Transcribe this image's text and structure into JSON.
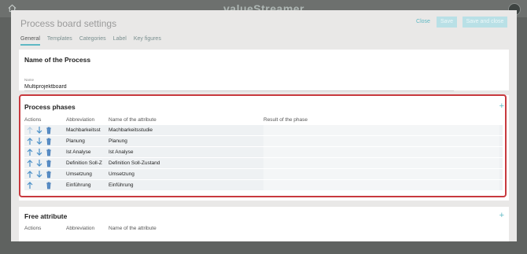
{
  "app": {
    "logo": "valueStreamer"
  },
  "modal": {
    "title": "Process board settings",
    "close_label": "Close",
    "save_label": "Save",
    "save_close_label": "Save and close"
  },
  "tabs": [
    {
      "label": "General"
    },
    {
      "label": "Templates"
    },
    {
      "label": "Categories"
    },
    {
      "label": "Label"
    },
    {
      "label": "Key figures"
    }
  ],
  "name_section": {
    "title": "Name of the Process",
    "field_label": "Name",
    "value": "Multiprojektboard"
  },
  "phases": {
    "title": "Process phases",
    "headers": {
      "actions": "Actions",
      "abbreviation": "Abbreviation",
      "name": "Name of the attribute",
      "result": "Result of the phase"
    },
    "rows": [
      {
        "abbr": "Machbarkeitsst",
        "name": "Machbarkeitsstudie",
        "result": ""
      },
      {
        "abbr": "Planung",
        "name": "Planung",
        "result": ""
      },
      {
        "abbr": "Ist Analyse",
        "name": "Ist Analyse",
        "result": ""
      },
      {
        "abbr": "Definition Soll-Z",
        "name": "Definition Soll-Zustand",
        "result": ""
      },
      {
        "abbr": "Umsetzung",
        "name": "Umsetzung",
        "result": ""
      },
      {
        "abbr": "Einführung",
        "name": "Einführung",
        "result": ""
      }
    ]
  },
  "free_attribute": {
    "title": "Free attribute",
    "headers": {
      "actions": "Actions",
      "abbreviation": "Abbreviation",
      "name": "Name of the attribute"
    }
  },
  "colors": {
    "accent": "#5fb9c4",
    "highlight": "#c8393e"
  }
}
